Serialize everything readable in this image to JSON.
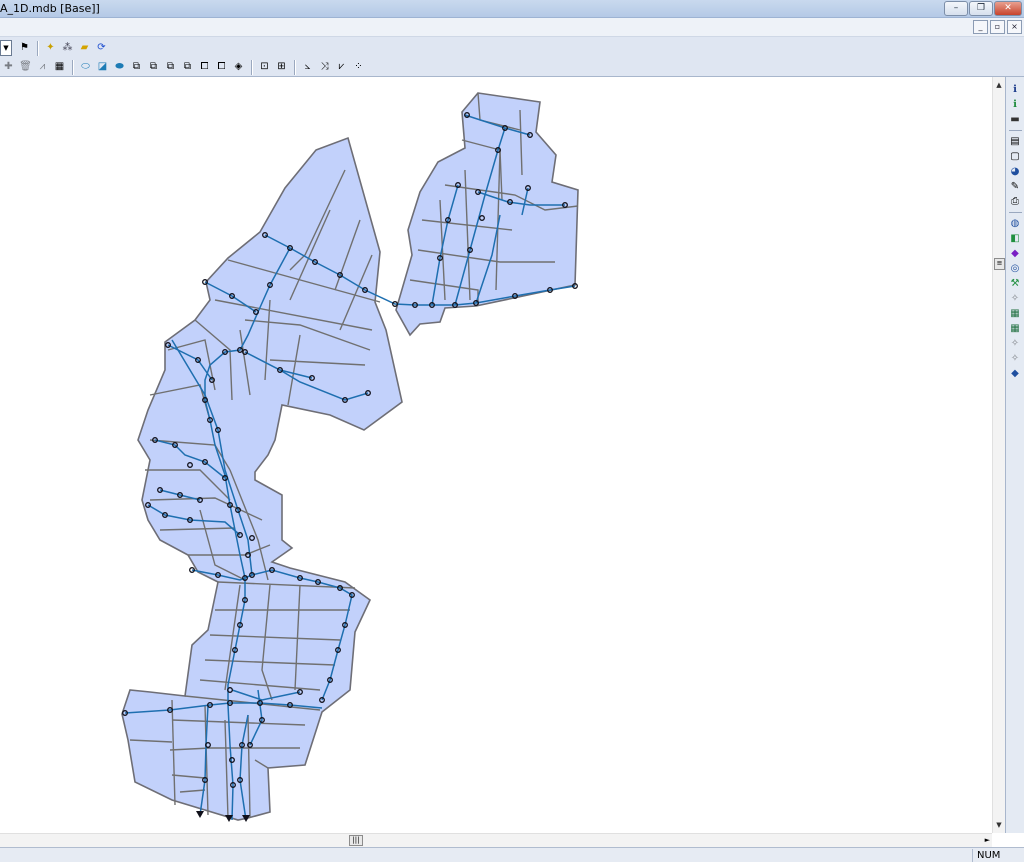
{
  "window": {
    "title": "A_1D.mdb [Base]]",
    "buttons": {
      "minimize": "–",
      "restore": "❐",
      "close": "✕"
    }
  },
  "mdi": {
    "minimize": "_",
    "restore": "▫",
    "close": "×"
  },
  "toolbar": {
    "row1": [
      {
        "name": "layer-dropdown",
        "glyph": "▼",
        "kind": "dropdown"
      },
      {
        "name": "flag-icon",
        "glyph": "⚑"
      },
      {
        "name": "sep"
      },
      {
        "name": "add-element-icon",
        "glyph": "✦",
        "color": "#c8a000"
      },
      {
        "name": "network-icon",
        "glyph": "⁂",
        "color": "#445"
      },
      {
        "name": "folder-icon",
        "glyph": "▰",
        "color": "#d4a400"
      },
      {
        "name": "refresh-icon",
        "glyph": "⟳",
        "color": "#1f4fd0"
      }
    ],
    "row2": [
      {
        "name": "add-icon",
        "glyph": "✚",
        "disabled": true
      },
      {
        "name": "delete-icon",
        "glyph": "🗑",
        "disabled": true
      },
      {
        "name": "chart-icon",
        "glyph": "⩘",
        "disabled": true
      },
      {
        "name": "edit-table-icon",
        "glyph": "▦"
      },
      {
        "name": "sep"
      },
      {
        "name": "subcatchment-icon",
        "glyph": "⬭",
        "color": "#1d7bb5"
      },
      {
        "name": "node-icon",
        "glyph": "◪",
        "color": "#1d7bb5"
      },
      {
        "name": "link-icon",
        "glyph": "⬬",
        "color": "#1d7bb5"
      },
      {
        "name": "select-icon-1",
        "glyph": "⧉"
      },
      {
        "name": "select-icon-2",
        "glyph": "⧉"
      },
      {
        "name": "select-icon-3",
        "glyph": "⧉"
      },
      {
        "name": "select-icon-4",
        "glyph": "⧉"
      },
      {
        "name": "copy-icon",
        "glyph": "⧠"
      },
      {
        "name": "paste-icon",
        "glyph": "⧠"
      },
      {
        "name": "tag-icon",
        "glyph": "◈"
      },
      {
        "name": "sep"
      },
      {
        "name": "export-icon",
        "glyph": "⊡"
      },
      {
        "name": "import-icon",
        "glyph": "⊞"
      },
      {
        "name": "sep"
      },
      {
        "name": "profile-icon",
        "glyph": "⦣"
      },
      {
        "name": "flow-icon",
        "glyph": "⤨"
      },
      {
        "name": "graph-icon",
        "glyph": "⩗"
      },
      {
        "name": "coordinate-icon",
        "glyph": "⁘"
      }
    ]
  },
  "right_toolbar": [
    {
      "name": "info-icon",
      "glyph": "ℹ",
      "color": "#1a3a8a"
    },
    {
      "name": "info-green-icon",
      "glyph": "ℹ",
      "color": "#1a8a3a"
    },
    {
      "name": "minus-icon",
      "glyph": "▬",
      "color": "#333"
    },
    {
      "name": "sep"
    },
    {
      "name": "properties-icon",
      "glyph": "▤"
    },
    {
      "name": "frame-icon",
      "glyph": "▢"
    },
    {
      "name": "zoom-icon",
      "glyph": "◕",
      "color": "#1f4f9f"
    },
    {
      "name": "edit-icon",
      "glyph": "✎"
    },
    {
      "name": "print-icon",
      "glyph": "⎙"
    },
    {
      "name": "sep"
    },
    {
      "name": "globe-icon",
      "glyph": "◍",
      "color": "#1f4f9f"
    },
    {
      "name": "layers-icon",
      "glyph": "◧",
      "color": "#1f8f3f"
    },
    {
      "name": "pin-icon",
      "glyph": "◆",
      "color": "#7a1fc4"
    },
    {
      "name": "search-icon",
      "glyph": "◎",
      "color": "#1f4f9f"
    },
    {
      "name": "tools-icon",
      "glyph": "⚒",
      "color": "#1f8f3f"
    },
    {
      "name": "tool-disabled-icon",
      "glyph": "✧",
      "disabled": true
    },
    {
      "name": "grid-icon",
      "glyph": "▦",
      "color": "#1f6f3f"
    },
    {
      "name": "grid-2-icon",
      "glyph": "▦",
      "color": "#1f6f3f"
    },
    {
      "name": "tool-disabled-2-icon",
      "glyph": "✧",
      "disabled": true
    },
    {
      "name": "tool-disabled-3-icon",
      "glyph": "✧",
      "disabled": true
    },
    {
      "name": "cube-icon",
      "glyph": "◆",
      "color": "#1f4f9f"
    }
  ],
  "scroll": {
    "up": "▲",
    "down": "▼",
    "thumb": "≡",
    "right": "►",
    "hthumb": "|||"
  },
  "status": {
    "num": "NUM"
  },
  "colors": {
    "polygon_fill": "#c2d1fb",
    "polygon_edge": "#6e6e76",
    "subarea_line": "#707070",
    "pipe": "#1e6fb0",
    "node": "#10101a"
  }
}
